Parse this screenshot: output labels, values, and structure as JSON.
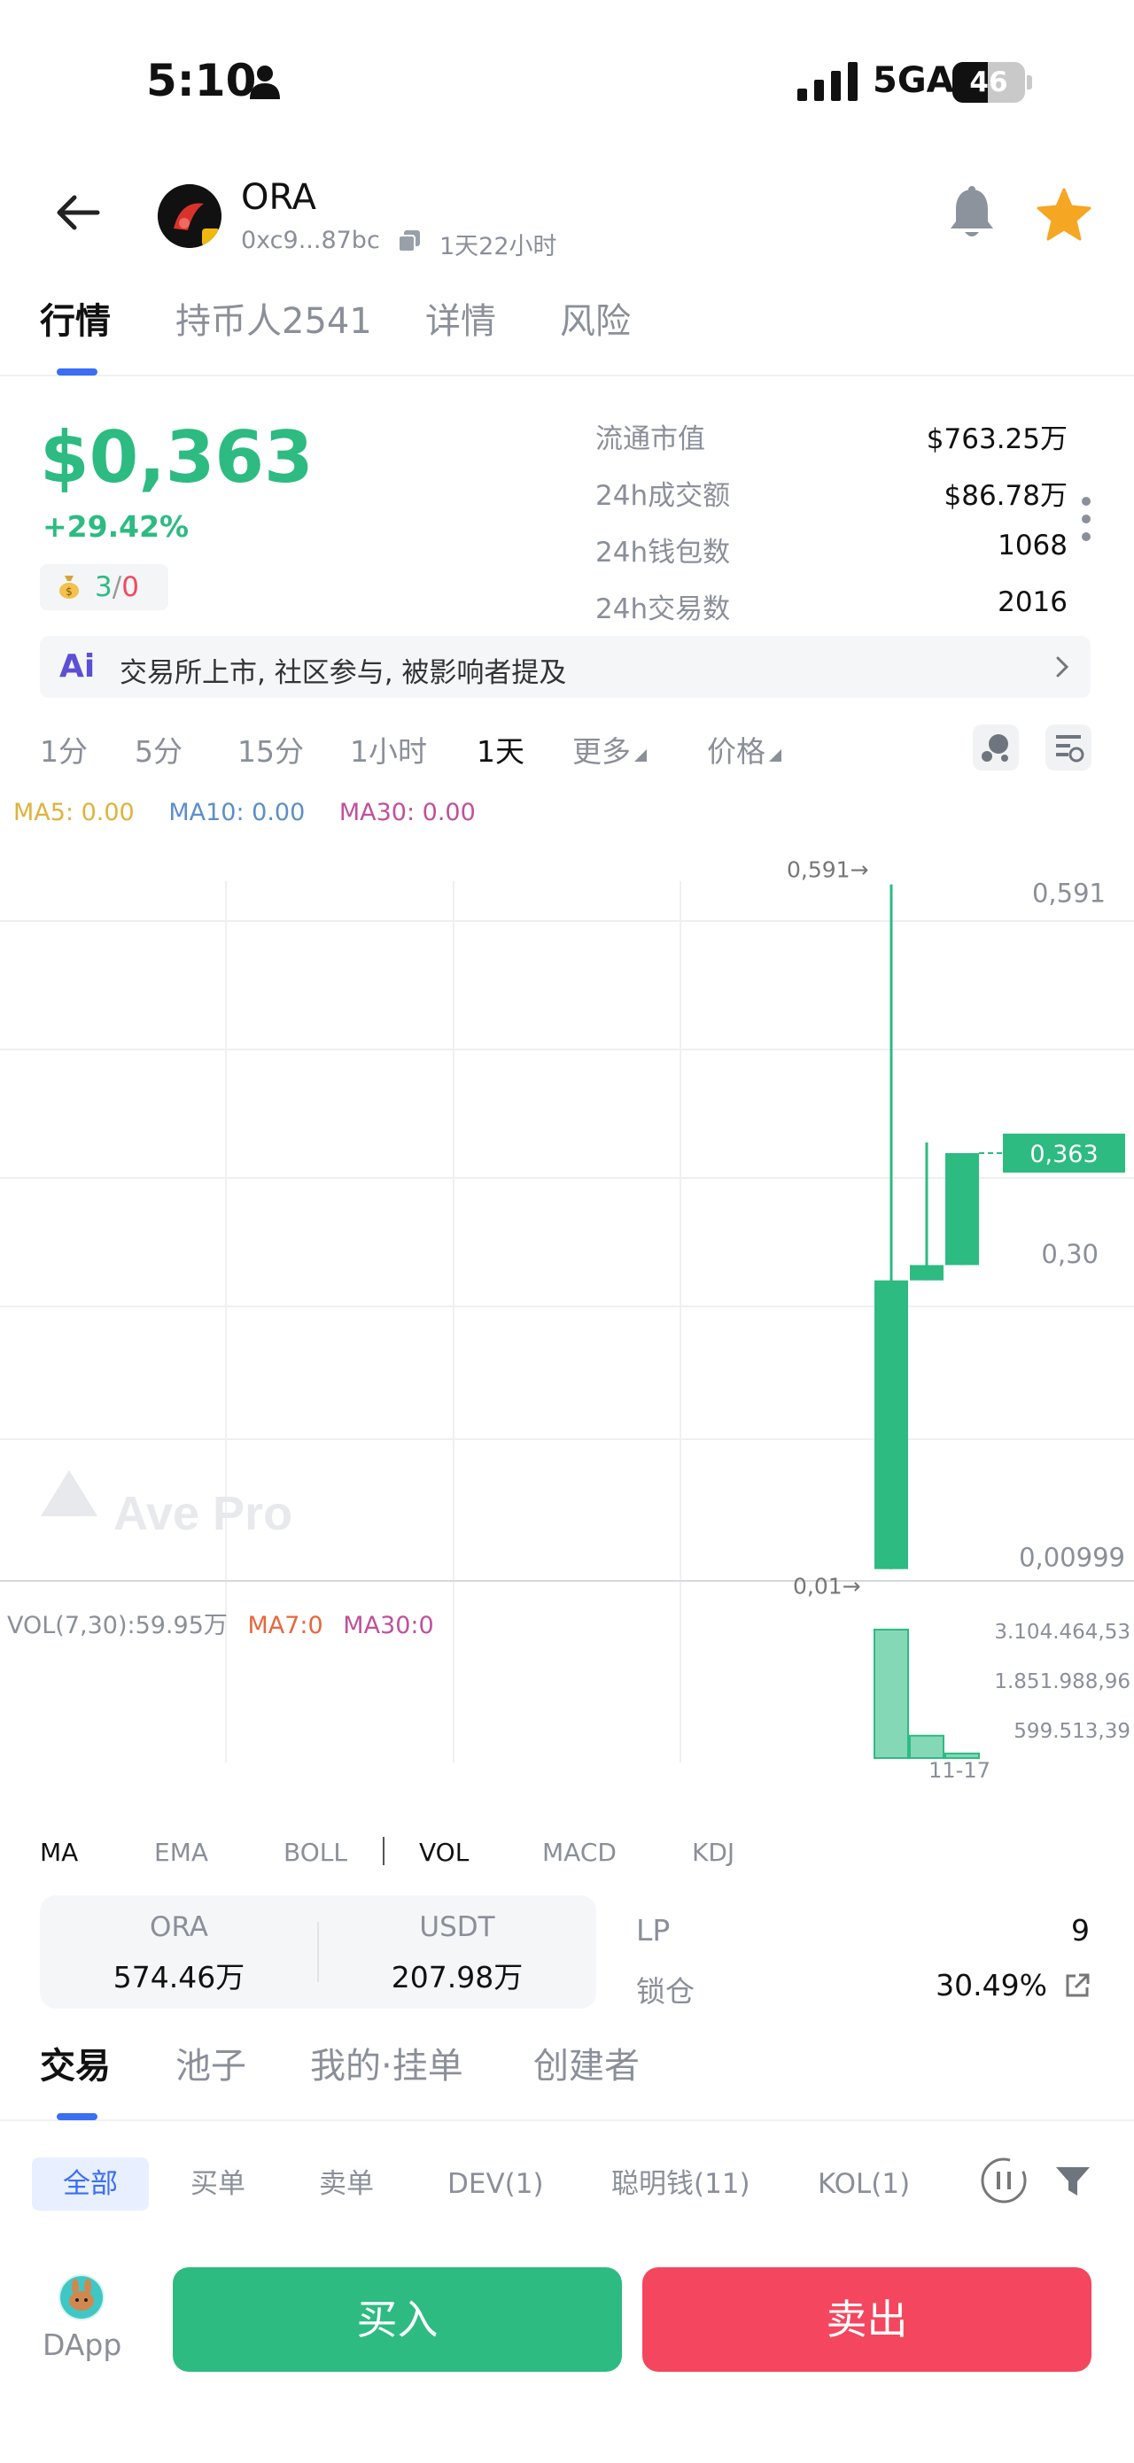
{
  "status_bar": {
    "time": "5:10",
    "network": "5GA",
    "battery": "46"
  },
  "header": {
    "token_name": "ORA",
    "address": "0xc9...87bc",
    "age": "1天22小时"
  },
  "main_tabs": [
    {
      "label": "行情",
      "active": true
    },
    {
      "label": "持币人2541",
      "active": false
    },
    {
      "label": "详情",
      "active": false
    },
    {
      "label": "风险",
      "active": false
    }
  ],
  "summary": {
    "price": "$0,363",
    "change": "+29.42%",
    "badge_green": "3",
    "badge_sep": "/",
    "badge_red": "0",
    "stats": [
      {
        "label": "流通市值",
        "value": "$763.25万"
      },
      {
        "label": "24h成交额",
        "value": "$86.78万"
      },
      {
        "label": "24h钱包数",
        "value": "1068"
      },
      {
        "label": "24h交易数",
        "value": "2016"
      }
    ]
  },
  "ai_bar": {
    "icon_text": "Ai",
    "text": "交易所上市, 社区参与, 被影响者提及"
  },
  "timeframes": [
    {
      "label": "1分",
      "active": false
    },
    {
      "label": "5分",
      "active": false
    },
    {
      "label": "15分",
      "active": false
    },
    {
      "label": "1小时",
      "active": false
    },
    {
      "label": "1天",
      "active": true
    },
    {
      "label": "更多",
      "active": false
    },
    {
      "label": "价格",
      "active": false
    }
  ],
  "ma_legend": {
    "ma5": "MA5: 0.00",
    "ma10": "MA10: 0.00",
    "ma30": "MA30: 0.00"
  },
  "colors": {
    "up": "#2dbb82",
    "down": "#f4465e",
    "accent": "#3b6ef5",
    "ma5": "#e0b23a",
    "ma10": "#5b8fc9",
    "ma30": "#c0509a",
    "ma7": "#e8663d"
  },
  "chart_data": {
    "type": "candlestick",
    "watermark": "Ave Pro",
    "price_axis_labels": [
      "0,591",
      "0,30",
      "0,00999"
    ],
    "current_price_tag": "0,363",
    "high_marker": "0,591→",
    "low_marker": "0,01→",
    "candles": [
      {
        "open": 0.01,
        "close": 0.255,
        "high": 0.591,
        "low": 0.01
      },
      {
        "open": 0.255,
        "close": 0.268,
        "high": 0.372,
        "low": 0.255
      },
      {
        "open": 0.268,
        "close": 0.363,
        "high": 0.363,
        "low": 0.268
      }
    ],
    "ylim": [
      0.0,
      0.62
    ],
    "volume_legend": {
      "vol": "VOL(7,30):59.95万",
      "ma7": "MA7:0",
      "ma30": "MA30:0"
    },
    "volume_axis_labels": [
      "3.104.464,53",
      "1.851.988,96",
      "599.513,39"
    ],
    "volumes": [
      3104464.53,
      540000,
      110000
    ],
    "x_label": "11-17"
  },
  "indicator_tabs": [
    {
      "label": "MA",
      "active": true
    },
    {
      "label": "EMA",
      "active": false
    },
    {
      "label": "BOLL",
      "active": false
    },
    {
      "label": "VOL",
      "active": true
    },
    {
      "label": "MACD",
      "active": false
    },
    {
      "label": "KDJ",
      "active": false
    }
  ],
  "pool": {
    "left_symbol": "ORA",
    "left_value": "574.46万",
    "right_symbol": "USDT",
    "right_value": "207.98万",
    "lp_label": "LP",
    "lp_value": "9",
    "lock_label": "锁仓",
    "lock_value": "30.49%"
  },
  "trade_tabs": [
    {
      "label": "交易",
      "active": true
    },
    {
      "label": "池子",
      "active": false
    },
    {
      "label": "我的·挂单",
      "active": false
    },
    {
      "label": "创建者",
      "active": false
    }
  ],
  "filters": [
    {
      "label": "全部",
      "active": true
    },
    {
      "label": "买单",
      "active": false
    },
    {
      "label": "卖单",
      "active": false
    },
    {
      "label": "DEV(1)",
      "active": false
    },
    {
      "label": "聪明钱(11)",
      "active": false
    },
    {
      "label": "KOL(1)",
      "active": false
    }
  ],
  "bottom": {
    "dapp_label": "DApp",
    "buy_label": "买入",
    "sell_label": "卖出"
  }
}
